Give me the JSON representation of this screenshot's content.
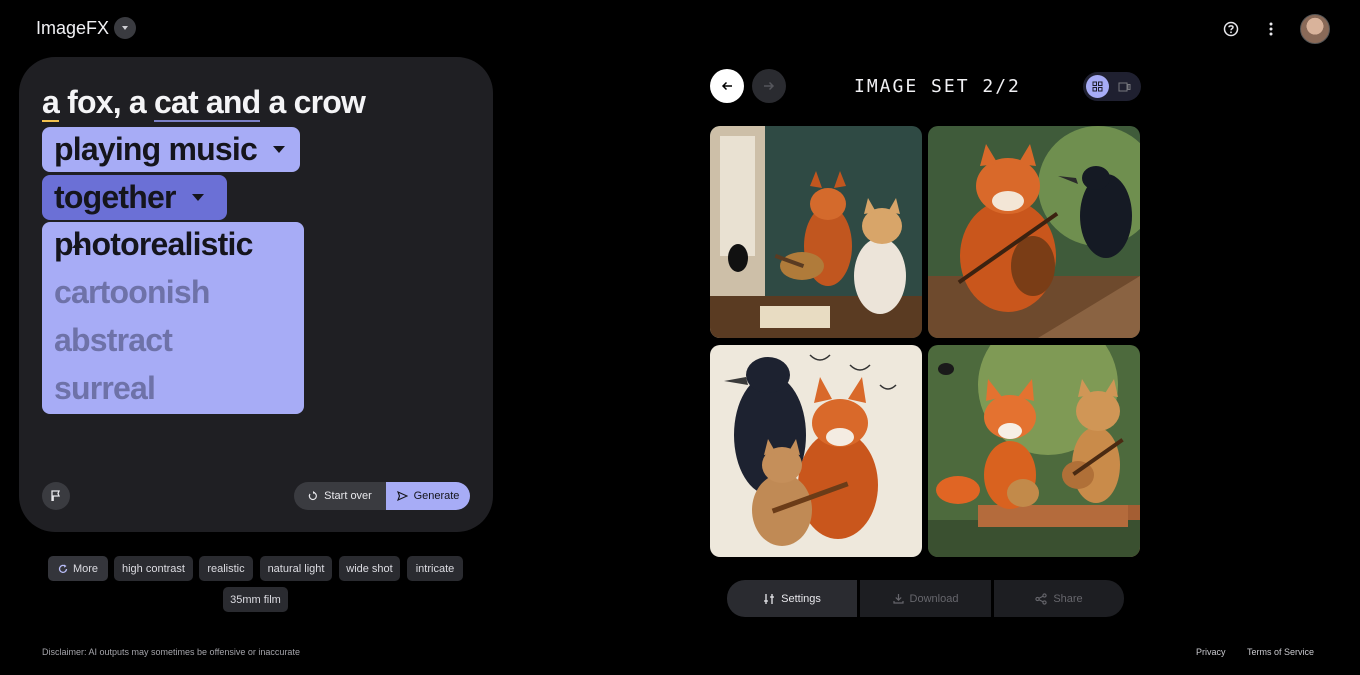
{
  "app": {
    "title": "ImageFX"
  },
  "prompt": {
    "line1_part1": "a fox, a ",
    "line1_word1": "a",
    "line1_word2": "cat and",
    "line1_part2": " a crow",
    "chips": [
      {
        "label": "playing music"
      },
      {
        "label": "together"
      }
    ],
    "dropdown": {
      "selected": "photorealistic",
      "options": [
        "cartoonish",
        "abstract",
        "surreal"
      ]
    }
  },
  "actions": {
    "start_over": "Start over",
    "generate": "Generate"
  },
  "suggestions": {
    "more": "More",
    "items": [
      "high contrast",
      "realistic",
      "natural light",
      "wide shot",
      "intricate",
      "35mm film"
    ]
  },
  "gallery": {
    "title": "IMAGE SET 2/2",
    "images": [
      {
        "icon": "fox-cat-crow-room-image"
      },
      {
        "icon": "fox-violin-crow-image"
      },
      {
        "icon": "crow-fox-kitten-music-image"
      },
      {
        "icon": "fox-kitten-guitar-image"
      }
    ]
  },
  "toolbar": {
    "settings": "Settings",
    "download": "Download",
    "share": "Share"
  },
  "footer": {
    "disclaimer": "Disclaimer: AI outputs may sometimes be offensive or inaccurate",
    "privacy": "Privacy",
    "terms": "Terms of Service"
  },
  "colors": {
    "accent": "#a7acf6",
    "accent_dark": "#6b70d6",
    "panel": "#1f1f23",
    "background": "#000000"
  }
}
